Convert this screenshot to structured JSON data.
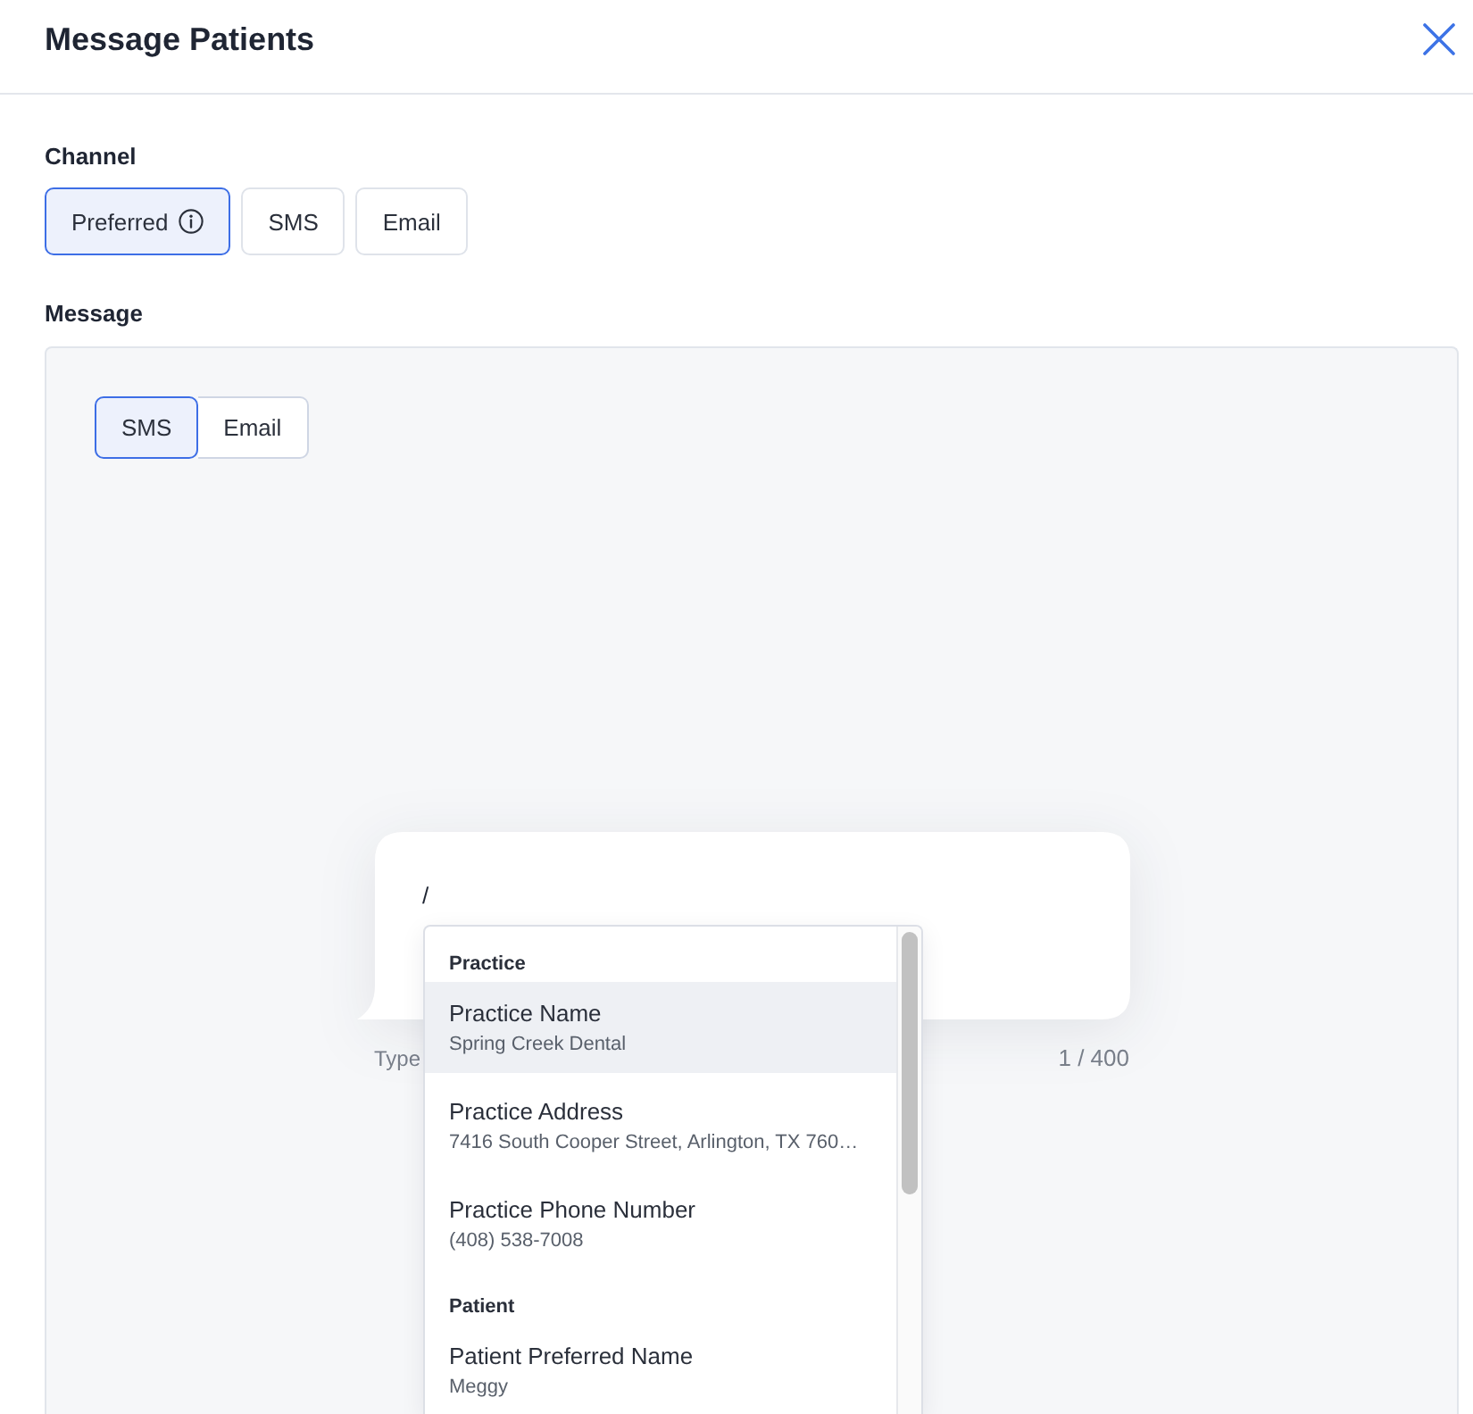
{
  "dialog": {
    "title": "Message Patients"
  },
  "channel": {
    "label": "Channel",
    "options": [
      {
        "label": "Preferred",
        "selected": true,
        "info": true
      },
      {
        "label": "SMS",
        "selected": false,
        "info": false
      },
      {
        "label": "Email",
        "selected": false,
        "info": false
      }
    ]
  },
  "message": {
    "label": "Message",
    "formats": [
      {
        "label": "SMS",
        "selected": true
      },
      {
        "label": "Email",
        "selected": false
      }
    ],
    "composer": {
      "value": "/",
      "helper_text": "Type",
      "counter": "1 / 400"
    },
    "variable_menu": {
      "groups": [
        {
          "heading": "Practice",
          "items": [
            {
              "name": "Practice Name",
              "value": "Spring Creek Dental",
              "selected": true
            },
            {
              "name": "Practice Address",
              "value": "7416 South Cooper Street, Arlington, TX 760…",
              "selected": false
            },
            {
              "name": "Practice Phone Number",
              "value": "(408) 538-7008",
              "selected": false
            }
          ]
        },
        {
          "heading": "Patient",
          "items": [
            {
              "name": "Patient Preferred Name",
              "value": "Meggy",
              "selected": false
            }
          ]
        }
      ]
    }
  }
}
